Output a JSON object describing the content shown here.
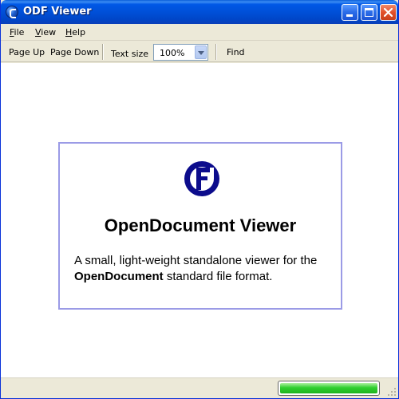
{
  "window": {
    "title": "ODF Viewer"
  },
  "menu": {
    "file": {
      "accel": "F",
      "rest": "ile"
    },
    "view": {
      "accel": "V",
      "rest": "iew"
    },
    "help": {
      "accel": "H",
      "rest": "elp"
    }
  },
  "toolbar": {
    "page_up": "Page Up",
    "page_down": "Page Down",
    "text_size_label": "Text size",
    "text_size_value": "100%",
    "find": "Find"
  },
  "content": {
    "title": "OpenDocument Viewer",
    "desc_pre": "A small, light-weight standalone viewer for the ",
    "desc_bold": "OpenDocument",
    "desc_post": " standard file format."
  },
  "status": {
    "progress": 1.0
  },
  "colors": {
    "title_bar": "#0050d8",
    "logo": "#0c0c8c",
    "card_border": "#9b9be6",
    "progress": "#2fcf2f"
  },
  "icons": {
    "app": "odf-globe-icon",
    "logo": "odf-logo-icon"
  }
}
